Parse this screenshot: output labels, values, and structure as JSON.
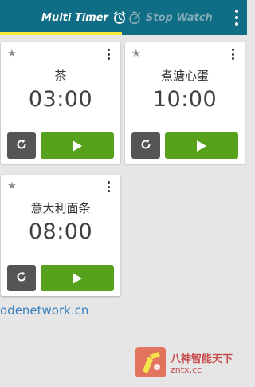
{
  "header": {
    "tab_multi_timer": "Multi Timer",
    "tab_stop_watch": "Stop Watch"
  },
  "timers": [
    {
      "name": "茶",
      "time": "03:00"
    },
    {
      "name": "煮溏心蛋",
      "time": "10:00"
    },
    {
      "name": "意大利面条",
      "time": "08:00"
    }
  ],
  "footer": {
    "link": "odenetwork.cn"
  },
  "watermark": {
    "title": "八神智能天下",
    "url": "zntx.cc"
  },
  "colors": {
    "header_bg": "#0f6e86",
    "tab_indicator": "#f2eb3a",
    "play_button": "#56a21c",
    "reset_button": "#555555",
    "page_bg": "#e6e6e6"
  },
  "icons": {
    "multi_timer": "alarm-clock-icon",
    "stop_watch": "stopwatch-icon",
    "overflow": "more-vert-icon",
    "favorite": "star-icon",
    "reset": "refresh-icon",
    "play": "play-icon"
  }
}
